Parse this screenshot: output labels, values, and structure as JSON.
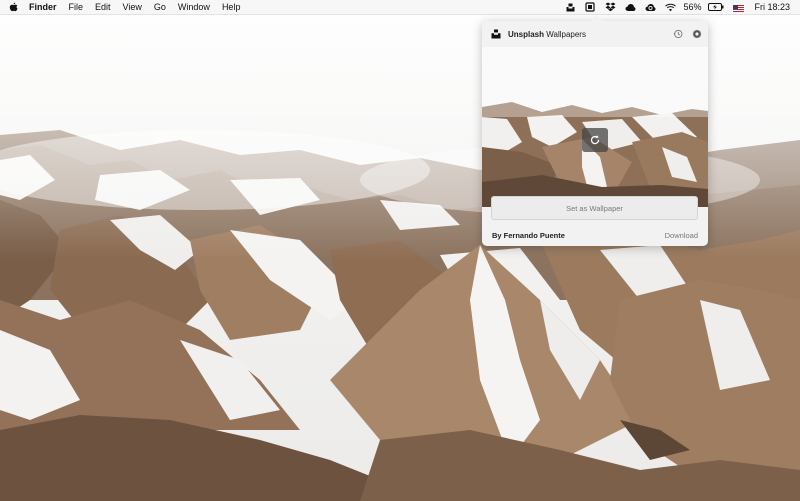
{
  "menubar": {
    "app_name": "Finder",
    "menus": [
      "File",
      "Edit",
      "View",
      "Go",
      "Window",
      "Help"
    ],
    "battery": "56%",
    "clock": "Fri 18:23",
    "status_icons": [
      "unsplash-icon",
      "screenshot-icon",
      "dropbox-icon",
      "cloud-icon",
      "creative-cloud-icon",
      "wifi-icon",
      "battery-icon",
      "flag-icon"
    ]
  },
  "popover": {
    "title_brand": "Unsplash",
    "title_rest": "Wallpapers",
    "set_button": "Set as Wallpaper",
    "credit": "By Fernando Puente",
    "download": "Download",
    "header_icons": [
      "history-icon",
      "gear-icon"
    ]
  }
}
